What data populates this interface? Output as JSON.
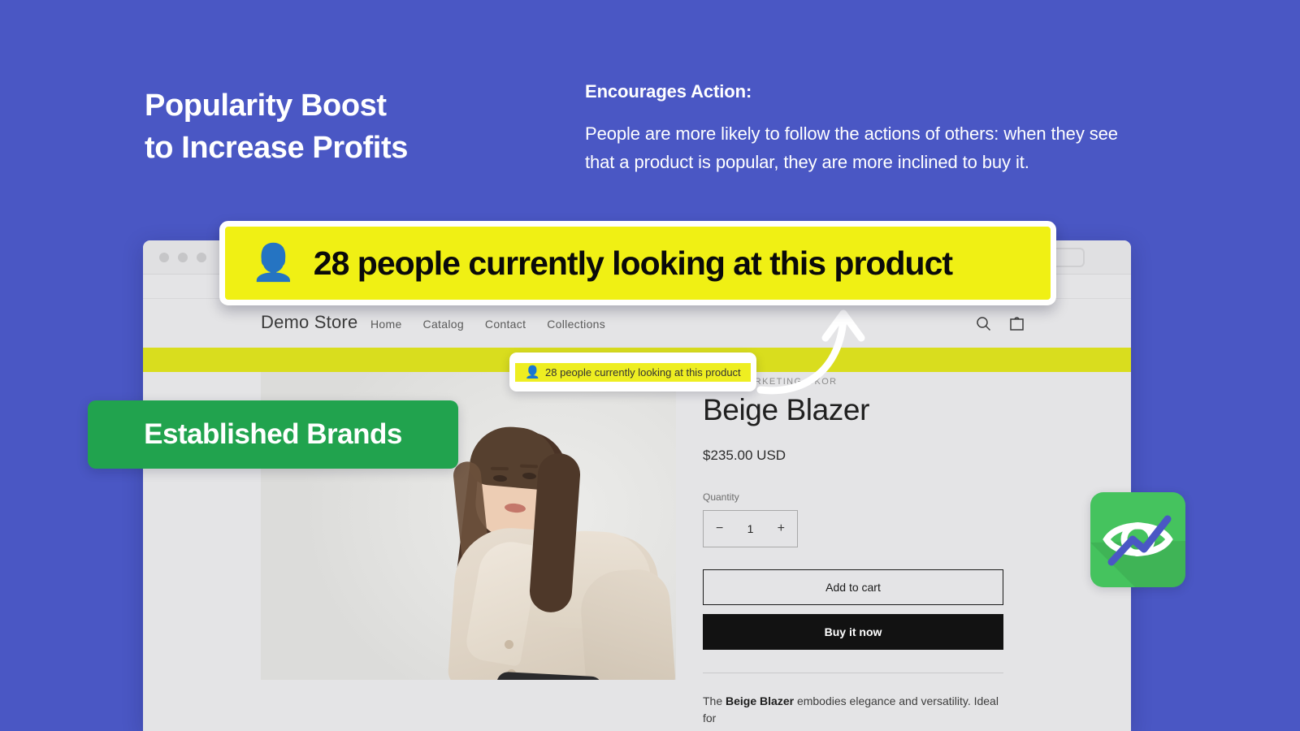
{
  "theme": {
    "background": "#4a57c4",
    "callout_yellow": "#f0f014",
    "banner_yellow": "#d9dd1e",
    "brand_green": "#21a34e",
    "logo_green": "#45c35e",
    "logo_accent": "#4a57c4"
  },
  "headline": "Popularity Boost\nto Increase Profits",
  "copy": {
    "heading": "Encourages Action:",
    "body": "People are more likely to follow the actions of others: when they see that a product is popular, they are more inclined to buy it."
  },
  "callout": {
    "icon": "person-icon",
    "text": "28 people currently looking at this product"
  },
  "tooltip": {
    "icon": "person-icon",
    "text": "28 people currently looking at this product"
  },
  "badge_brands": {
    "label": "Established Brands"
  },
  "browser": {
    "window_controls": [
      "dot",
      "dot",
      "dot"
    ],
    "address_button": ""
  },
  "store": {
    "name": "Demo Store",
    "nav": [
      {
        "label": "Home"
      },
      {
        "label": "Catalog"
      },
      {
        "label": "Contact"
      },
      {
        "label": "Collections"
      }
    ],
    "icons": [
      {
        "name": "search-icon"
      },
      {
        "name": "cart-icon"
      }
    ],
    "banner": {
      "icon": "person-icon",
      "text": "28 people currently looking at this product"
    }
  },
  "product": {
    "vendor": "SNIZE-MARKETING-GKOR",
    "title": "Beige Blazer",
    "price": "$235.00 USD",
    "quantity_label": "Quantity",
    "quantity": {
      "decrease": "−",
      "value": "1",
      "increase": "+"
    },
    "add_to_cart": "Add to cart",
    "buy_it_now": "Buy it now",
    "description_prefix": "The ",
    "description_bold": "Beige Blazer",
    "description_suffix": " embodies elegance and versatility. Ideal for"
  },
  "logo": {
    "name": "eye-trendline-logo"
  }
}
